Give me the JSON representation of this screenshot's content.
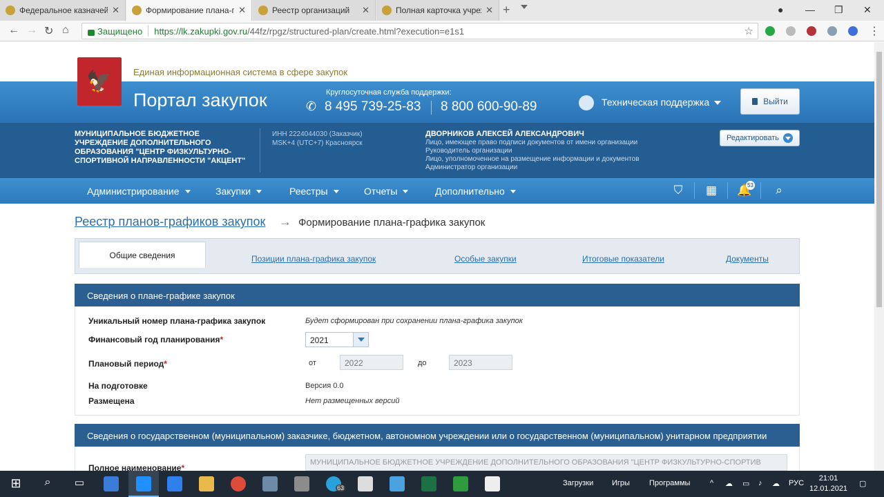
{
  "browser": {
    "tabs": [
      {
        "title": "Федеральное казначей",
        "active": false
      },
      {
        "title": "Формирование плана-г",
        "active": true
      },
      {
        "title": "Реестр организаций",
        "active": false
      },
      {
        "title": "Полная карточка учреж",
        "active": false
      }
    ],
    "secure_label": "Защищено",
    "url_host": "https://lk.zakupki.gov.ru",
    "url_path": "/44fz/rpgz/structured-plan/create.html?execution=e1s1"
  },
  "header": {
    "eis_title": "Единая информационная система в сфере закупок",
    "portal_title": "Портал закупок",
    "support_caption": "Круглосуточная служба поддержки:",
    "phone1": "8 495 739-25-83",
    "phone2": "8 800 600-90-89",
    "tech_support": "Техническая поддержка",
    "logout": "Выйти"
  },
  "org": {
    "name": "МУНИЦИПАЛЬНОЕ БЮДЖЕТНОЕ УЧРЕЖДЕНИЕ ДОПОЛНИТЕЛЬНОГО ОБРАЗОВАНИЯ \"ЦЕНТР ФИЗКУЛЬТУРНО-СПОРТИВНОЙ НАПРАВЛЕННОСТИ \"АКЦЕНТ\"",
    "inn": "ИНН 2224044030 (Заказчик)",
    "timezone": "MSK+4 (UTC+7) Красноярск",
    "user_name": "ДВОРНИКОВ АЛЕКСЕЙ АЛЕКСАНДРОВИЧ",
    "roles": [
      "Лицо, имеющее право подписи документов от имени организации",
      "Руководитель организации",
      "Лицо, уполномоченное на размещение информации и документов",
      "Администратор организации"
    ],
    "edit": "Редактировать"
  },
  "menu": {
    "items": [
      "Администрирование",
      "Закупки",
      "Реестры",
      "Отчеты",
      "Дополнительно"
    ],
    "notifications": "53"
  },
  "breadcrumb": {
    "link": "Реестр планов-графиков закупок",
    "arrow": "→",
    "current": "Формирование плана-графика закупок"
  },
  "page_tabs": {
    "active": "Общие сведения",
    "items": [
      "Позиции плана-графика закупок",
      "Особые закупки",
      "Итоговые показатели",
      "Документы"
    ]
  },
  "section1": {
    "title": "Сведения о плане-графике закупок",
    "unique_label": "Уникальный номер плана-графика закупок",
    "unique_value": "Будет сформирован при сохранении плана-графика закупок",
    "fin_year_label": "Финансовый год планирования",
    "fin_year_value": "2021",
    "period_label": "Плановый период",
    "from_label": "от",
    "from_value": "2022",
    "to_label": "до",
    "to_value": "2023",
    "prep_label": "На подготовке",
    "prep_value": "Версия 0.0",
    "placed_label": "Размещена",
    "placed_value": "Нет размещенных версий",
    "required_mark": "*"
  },
  "section2": {
    "title": "Сведения о государственном (муниципальном) заказчике, бюджетном, автономном учреждении или о государственном (муниципальном) унитарном предприятии",
    "fullname_label": "Полное наименование",
    "fullname_value": "МУНИЦИПАЛЬНОЕ БЮДЖЕТНОЕ УЧРЕЖДЕНИЕ ДОПОЛНИТЕЛЬНОГО ОБРАЗОВАНИЯ \"ЦЕНТР ФИЗКУЛЬТУРНО-СПОРТИВ"
  },
  "taskbar": {
    "downloads": "Загрузки",
    "games": "Игры",
    "programs": "Программы",
    "lang": "РУС",
    "time": "21:01",
    "date": "12.01.2021",
    "telegram_badge": "63"
  }
}
